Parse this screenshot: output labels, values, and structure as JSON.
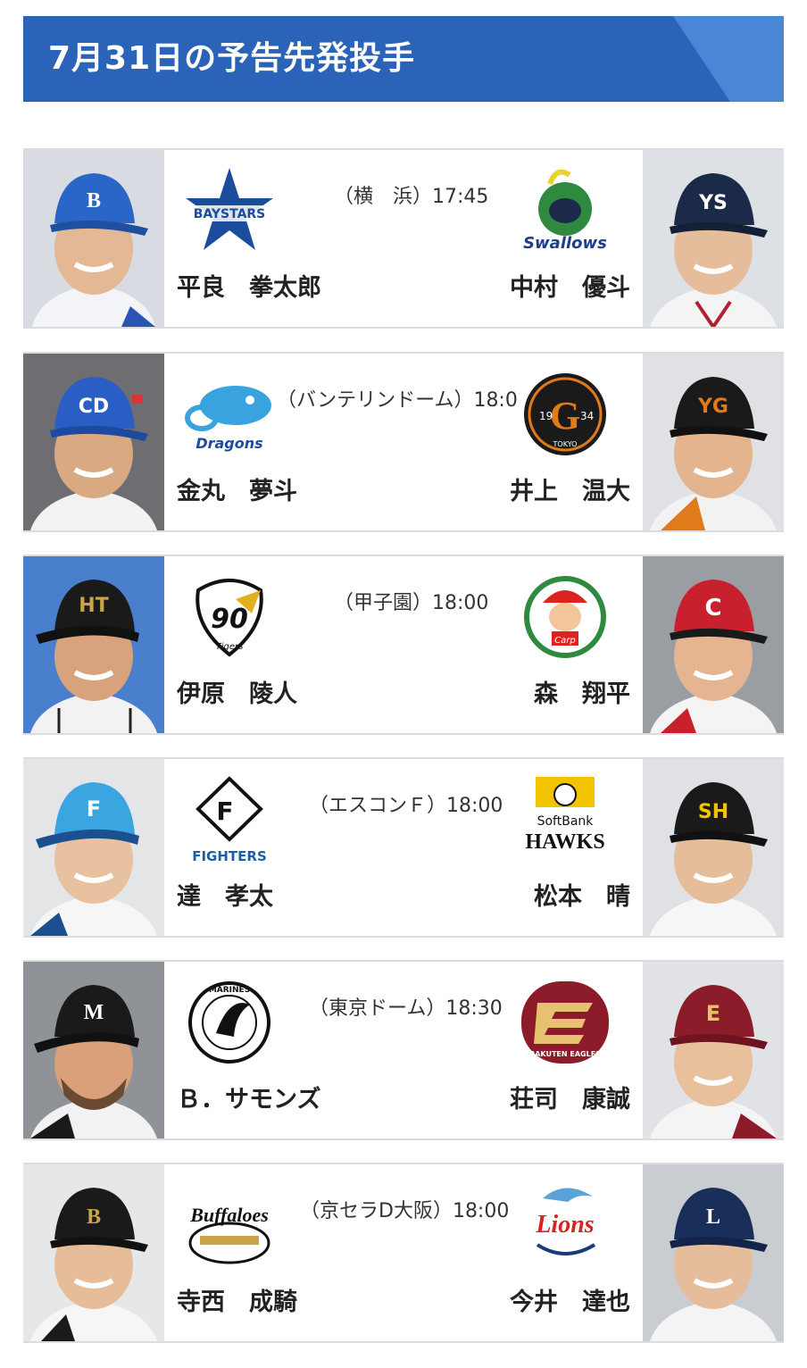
{
  "header": {
    "title": "7月31日の予告先発投手"
  },
  "games": [
    {
      "venue": "（横　浜）17:45",
      "home": {
        "pitcher": "平良　拳太郎",
        "team_logo": "baystars-logo",
        "logo_text": "BAYSTARS",
        "cap_letter": "B",
        "bg": "#d8dce2"
      },
      "away": {
        "pitcher": "中村　優斗",
        "team_logo": "swallows-logo",
        "logo_text": "Swallows",
        "cap_letter": "YS",
        "bg": "#dde0e4"
      }
    },
    {
      "venue": "（バンテリンドーム）18:0",
      "home": {
        "pitcher": "金丸　夢斗",
        "team_logo": "dragons-logo",
        "logo_text": "Dragons",
        "cap_letter": "CD",
        "bg": "#6e6e72"
      },
      "away": {
        "pitcher": "井上　温大",
        "team_logo": "giants-logo",
        "logo_text": "TOKYO",
        "cap_letter": "YG",
        "bg": "#dfe1e4"
      }
    },
    {
      "venue": "（甲子園）18:00",
      "home": {
        "pitcher": "伊原　陵人",
        "team_logo": "tigers-logo",
        "logo_text": "Tigers",
        "cap_letter": "HT",
        "bg": "#4a7fce"
      },
      "away": {
        "pitcher": "森　翔平",
        "team_logo": "carp-logo",
        "logo_text": "Carp",
        "cap_letter": "C",
        "bg": "#9a9ea3"
      }
    },
    {
      "venue": "（エスコンＦ）18:00",
      "home": {
        "pitcher": "達　孝太",
        "team_logo": "fighters-logo",
        "logo_text": "FIGHTERS",
        "cap_letter": "F",
        "bg": "#e4e5e7"
      },
      "away": {
        "pitcher": "松本　晴",
        "team_logo": "hawks-logo",
        "logo_text": "HAWKS",
        "cap_letter": "SH",
        "bg": "#dfe1e4"
      }
    },
    {
      "venue": "（東京ドーム）18:30",
      "home": {
        "pitcher": "Ｂ．サモンズ",
        "team_logo": "marines-logo",
        "logo_text": "MARINES",
        "cap_letter": "M",
        "bg": "#8f9398"
      },
      "away": {
        "pitcher": "荘司　康誠",
        "team_logo": "eagles-logo",
        "logo_text": "RAKUTEN EAGLES",
        "cap_letter": "E",
        "bg": "#e0e2e5"
      }
    },
    {
      "venue": "（京セラD大阪）18:00",
      "home": {
        "pitcher": "寺西　成騎",
        "team_logo": "buffaloes-logo",
        "logo_text": "Buffaloes",
        "cap_letter": "B",
        "bg": "#e6e7e9"
      },
      "away": {
        "pitcher": "今井　達也",
        "team_logo": "lions-logo",
        "logo_text": "Lions",
        "cap_letter": "L",
        "bg": "#c9cdd2"
      }
    }
  ],
  "colors": {
    "header_bg": "#2a63b8",
    "header_accent": "#4a86d6",
    "divider": "#dcdcdc"
  }
}
